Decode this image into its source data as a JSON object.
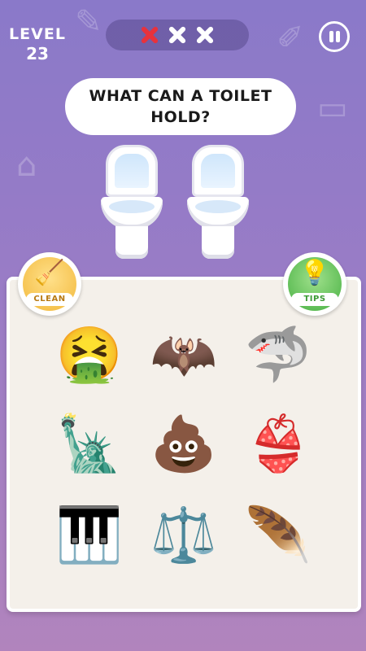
{
  "level": {
    "label": "LEVEL",
    "number": "23"
  },
  "strikes": {
    "total": 3,
    "used": 1,
    "used_color": "#e8323c",
    "unused_color": "#ffffff"
  },
  "question": {
    "text": "WHAT CAN A TOILET HOLD?"
  },
  "targets": [
    {
      "icon": "toilet-icon"
    },
    {
      "icon": "toilet-icon"
    }
  ],
  "powerups": {
    "clean": {
      "label": "CLEAN",
      "icon": "broom-icon",
      "glyph": "🧹"
    },
    "tips": {
      "label": "TIPS",
      "icon": "lightbulb-icon",
      "glyph": "💡"
    }
  },
  "items": [
    {
      "icon": "vomiting-face-icon",
      "glyph": "🤮"
    },
    {
      "icon": "bat-icon",
      "glyph": "🦇"
    },
    {
      "icon": "shark-icon",
      "glyph": "🦈"
    },
    {
      "icon": "statue-of-liberty-icon",
      "glyph": "🗽"
    },
    {
      "icon": "poop-icon",
      "glyph": "💩"
    },
    {
      "icon": "bikini-top-icon",
      "glyph": "👙"
    },
    {
      "icon": "piano-icon",
      "glyph": "🎹"
    },
    {
      "icon": "scales-icon",
      "glyph": "⚖️"
    },
    {
      "icon": "feather-headdress-icon",
      "glyph": "🪶"
    }
  ],
  "colors": {
    "background_top": "#8a79c9",
    "background_bottom": "#b184bd",
    "board": "#f4f0ea"
  }
}
